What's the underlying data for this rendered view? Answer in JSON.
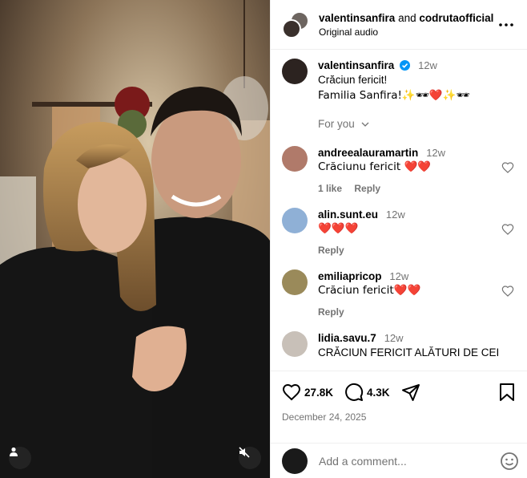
{
  "header": {
    "user1": "valentinsanfira",
    "and": "and",
    "user2": "codrutaofficial",
    "audio": "Original audio",
    "more_icon": "more-horizontal-icon"
  },
  "caption": {
    "username": "valentinsanfira",
    "time": "12w",
    "line1": "Crăciun fericit!",
    "line2": "Familia Sanfira!✨🕶❤️✨🕶"
  },
  "for_you": "For you",
  "comments": [
    {
      "username": "andreealauramartin",
      "time": "12w",
      "text": "Crăciunu fericit ❤️❤️",
      "likes": "1 like",
      "reply": "Reply",
      "color": "#b07a6a"
    },
    {
      "username": "alin.sunt.eu",
      "time": "12w",
      "text": "❤️❤️❤️",
      "reply": "Reply",
      "color": "#8fb0d6"
    },
    {
      "username": "emiliapricop",
      "time": "12w",
      "text": "Crăciun fericit❤️❤️",
      "reply": "Reply",
      "color": "#9a8a5a"
    },
    {
      "username": "lidia.savu.7",
      "time": "12w",
      "text": "CRĂCIUN FERICIT ALĂTURI DE CEI",
      "color": "#c8c0b8"
    }
  ],
  "actions": {
    "likes": "27.8K",
    "comments": "4.3K",
    "date": "December 24, 2025"
  },
  "add_comment": {
    "placeholder": "Add a comment..."
  },
  "colors": {
    "verified": "#0095f6",
    "muted": "#737373"
  }
}
